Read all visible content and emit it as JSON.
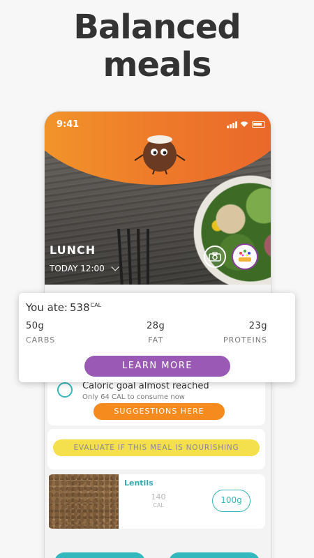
{
  "headline": {
    "line1": "Balanced",
    "line2": "meals"
  },
  "status_bar": {
    "time": "9:41"
  },
  "meal": {
    "title": "LUNCH",
    "time": "TODAY 12:00"
  },
  "summary": {
    "ate_label": "You ate:",
    "ate_value": "538",
    "ate_unit": "CAL",
    "macros": [
      {
        "value": "50g",
        "label": "CARBS"
      },
      {
        "value": "28g",
        "label": "FAT"
      },
      {
        "value": "23g",
        "label": "PROTEINS"
      }
    ],
    "learn_more": "LEARN MORE"
  },
  "goal": {
    "title": "Caloric goal almost reached",
    "subtitle": "Only 64 CAL to consume now",
    "button": "SUGGESTIONS HERE"
  },
  "evaluate": {
    "button": "EVALUATE IF THIS MEAL IS NOURISHING"
  },
  "food": {
    "name": "Lentils",
    "calories": "140",
    "cal_unit": "CAL",
    "quantity": "100g"
  },
  "colors": {
    "accent_orange": "#f58b1e",
    "teal": "#39b5ba",
    "purple": "#9b59b6",
    "yellow": "#f4e04d"
  },
  "icons": [
    "signal-icon",
    "wifi-icon",
    "battery-icon",
    "coconut-mascot",
    "camera-icon",
    "badge-icon",
    "chevron-down-icon"
  ]
}
